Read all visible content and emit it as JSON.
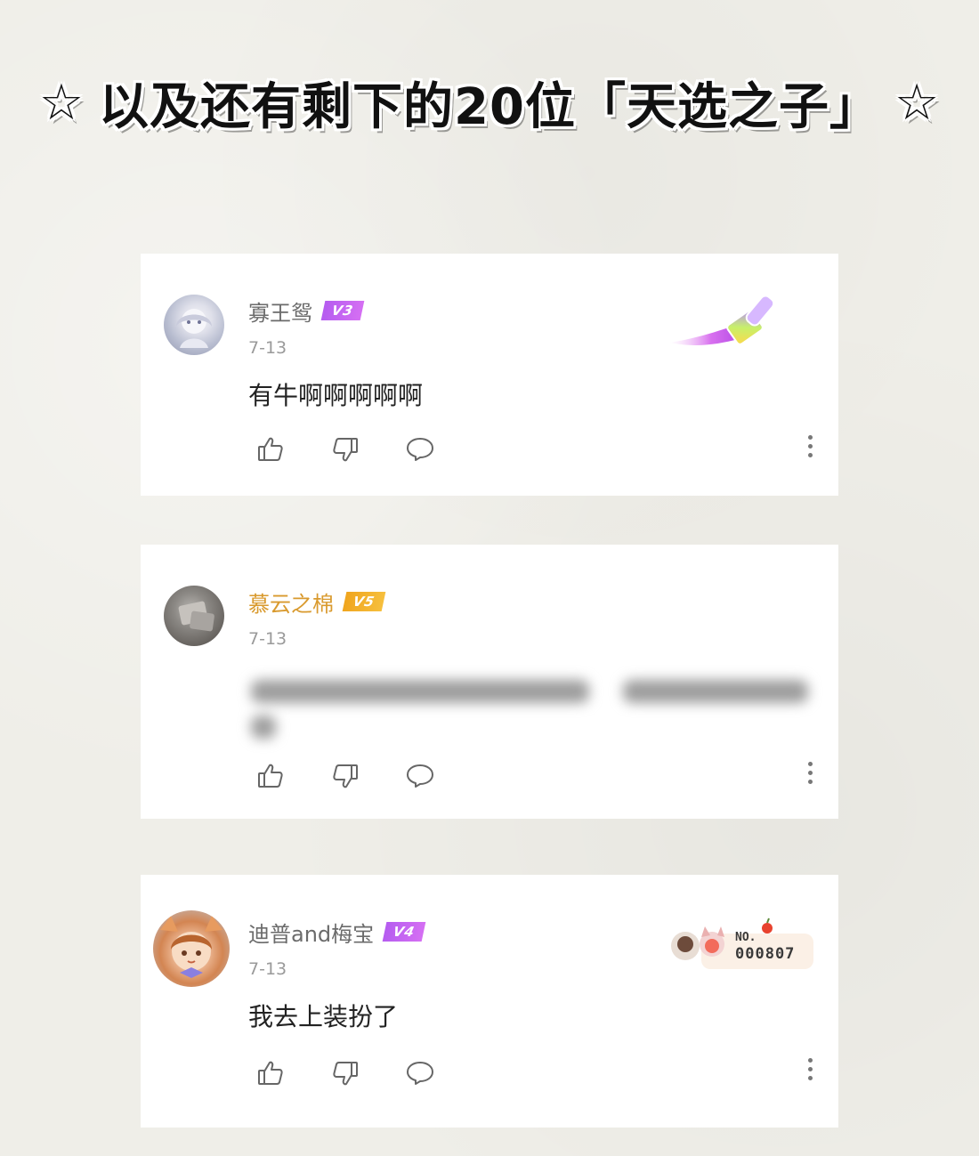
{
  "headline": {
    "star_left": "☆",
    "text": "以及还有剩下的20位「天选之子」",
    "star_right": "☆"
  },
  "comments": [
    {
      "username": "寡王鸳",
      "level": "V3",
      "date": "7-13",
      "text": "有牛啊啊啊啊啊",
      "name_color": "#6b6b6b",
      "badge_color": "#c566f2",
      "decoration_icon": "paint-brush-icon"
    },
    {
      "username": "慕云之棉",
      "level": "V5",
      "date": "7-13",
      "text": "",
      "name_color": "#d99a2e",
      "badge_color": "#f2ac25",
      "content_state": "blurred"
    },
    {
      "username": "迪普and梅宝",
      "level": "V4",
      "date": "7-13",
      "text": "我去上装扮了",
      "name_color": "#6b6b6b",
      "badge_color": "#c566f2",
      "fan_badge": {
        "no_label": "NO.",
        "number": "000807"
      }
    }
  ],
  "icons": {
    "like": "thumbs-up-icon",
    "dislike": "thumbs-down-icon",
    "reply": "comment-bubble-icon",
    "more": "more-vertical-icon"
  }
}
